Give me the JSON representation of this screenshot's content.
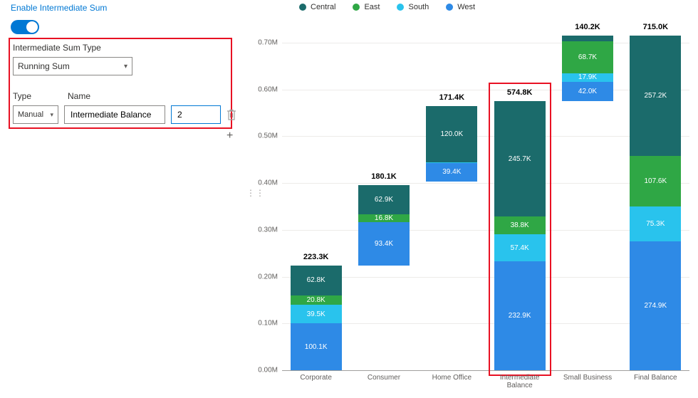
{
  "header": {
    "label": "Enable Intermediate Sum"
  },
  "toggle": {
    "on": true
  },
  "panel": {
    "sum_type_label": "Intermediate Sum Type",
    "sum_type_value": "Running Sum",
    "type_label": "Type",
    "name_label": "Name",
    "type_value": "Manual",
    "name_value": "Intermediate Balance",
    "pos_value": "2"
  },
  "legend": {
    "items": [
      {
        "label": "Central",
        "color": "#1b6b6b"
      },
      {
        "label": "East",
        "color": "#2fa745"
      },
      {
        "label": "South",
        "color": "#29c3ed"
      },
      {
        "label": "West",
        "color": "#2e8ae6"
      }
    ]
  },
  "colors": {
    "Central": "#1b6b6b",
    "East": "#2fa745",
    "South": "#29c3ed",
    "West": "#2e8ae6"
  },
  "chart_data": {
    "type": "bar",
    "stacked": true,
    "waterfall_like": true,
    "ylabel": "",
    "ylim": [
      0,
      0.75
    ],
    "y_ticks": [
      "0.00M",
      "0.10M",
      "0.20M",
      "0.30M",
      "0.40M",
      "0.50M",
      "0.60M",
      "0.70M"
    ],
    "y_tick_values": [
      0,
      100000,
      200000,
      300000,
      400000,
      500000,
      600000,
      700000
    ],
    "categories": [
      "Corporate",
      "Consumer",
      "Home Office",
      "Intermediate Balance",
      "Small Business",
      "Final Balance"
    ],
    "series": [
      {
        "name": "Central",
        "color": "#1b6b6b"
      },
      {
        "name": "East",
        "color": "#2fa745"
      },
      {
        "name": "South",
        "color": "#29c3ed"
      },
      {
        "name": "West",
        "color": "#2e8ae6"
      }
    ],
    "bars": [
      {
        "category": "Corporate",
        "total_label": "223.3K",
        "base": 0,
        "segments": [
          {
            "series": "West",
            "value": 100100,
            "label": "100.1K"
          },
          {
            "series": "South",
            "value": 39500,
            "label": "39.5K"
          },
          {
            "series": "East",
            "value": 20800,
            "label": "20.8K"
          },
          {
            "series": "Central",
            "value": 62800,
            "label": "62.8K"
          }
        ]
      },
      {
        "category": "Consumer",
        "total_label": "180.1K",
        "base": 223300,
        "segments": [
          {
            "series": "West",
            "value": 93400,
            "label": "93.4K"
          },
          {
            "series": "East",
            "value": 16800,
            "label": "16.8K"
          },
          {
            "series": "Central",
            "value": 62900,
            "label": "62.9K"
          }
        ]
      },
      {
        "category": "Home Office",
        "total_label": "171.4K",
        "base": 403400,
        "segments": [
          {
            "series": "West",
            "value": 39400,
            "label": "39.4K"
          },
          {
            "series": "South",
            "value": 1200,
            "label": "1.2K"
          },
          {
            "series": "Central",
            "value": 120000,
            "label": "120.0K"
          }
        ]
      },
      {
        "category": "Intermediate Balance",
        "total_label": "574.8K",
        "base": 0,
        "highlight": true,
        "segments": [
          {
            "series": "West",
            "value": 232900,
            "label": "232.9K"
          },
          {
            "series": "South",
            "value": 57400,
            "label": "57.4K"
          },
          {
            "series": "East",
            "value": 38800,
            "label": "38.8K"
          },
          {
            "series": "Central",
            "value": 245700,
            "label": "245.7K"
          }
        ]
      },
      {
        "category": "Small Business",
        "total_label": "140.2K",
        "base": 574800,
        "segments": [
          {
            "series": "West",
            "value": 42000,
            "label": "42.0K"
          },
          {
            "series": "South",
            "value": 17900,
            "label": "17.9K"
          },
          {
            "series": "East",
            "value": 68700,
            "label": "68.7K"
          },
          {
            "series": "Central",
            "value": 11500,
            "label": "11.5K"
          }
        ]
      },
      {
        "category": "Final Balance",
        "total_label": "715.0K",
        "base": 0,
        "segments": [
          {
            "series": "West",
            "value": 274900,
            "label": "274.9K"
          },
          {
            "series": "South",
            "value": 75300,
            "label": "75.3K"
          },
          {
            "series": "East",
            "value": 107600,
            "label": "107.6K"
          },
          {
            "series": "Central",
            "value": 257200,
            "label": "257.2K"
          }
        ]
      }
    ]
  }
}
